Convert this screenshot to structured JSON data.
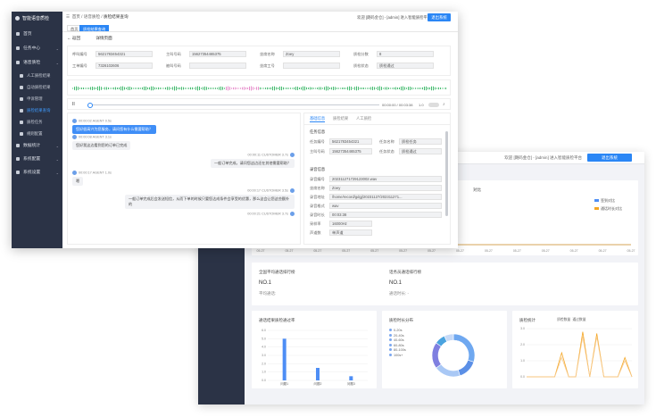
{
  "back_window": {
    "top_text": "欢迎 [朗码金仓] - [admin] 进入智能质检平台",
    "top_button": "退出系统",
    "chart_title": "对比",
    "legend": [
      "签到对比",
      "通话时长对比"
    ],
    "cards": [
      {
        "title": "全国平均通话排行榜",
        "value": "NO.1",
        "sub": "平均通话:"
      },
      {
        "title": "话务员通话排行榜",
        "value": "NO.1",
        "sub": "通话时长:  -"
      }
    ],
    "bar_panel_title": "通话结果质检通过率",
    "pie_panel_title": "质检时长分布",
    "pie_legend": [
      "0-20s",
      "20-40s",
      "40-60s",
      "60-80s",
      "80-100s",
      "100s+"
    ],
    "line_panel_title": "质检统计",
    "line_legend": [
      "质检数量",
      "通过数量"
    ],
    "colors": {
      "blue": "#4e8ef5",
      "orange": "#f5a623",
      "side": "#2b3346"
    }
  },
  "front": {
    "logo": "智能语音质检",
    "nav": [
      {
        "label": "首页",
        "sub": false,
        "active": false
      },
      {
        "label": "任务中心",
        "sub": false,
        "active": false,
        "chev": true
      },
      {
        "label": "语音质检",
        "sub": false,
        "active": false,
        "chev": true
      },
      {
        "label": "人工质检结果",
        "sub": true,
        "active": false
      },
      {
        "label": "自动质检结果",
        "sub": true,
        "active": false
      },
      {
        "label": "申诉管理",
        "sub": true,
        "active": false
      },
      {
        "label": "质检结果查询",
        "sub": true,
        "active": true
      },
      {
        "label": "质检任务",
        "sub": true,
        "active": false
      },
      {
        "label": "规则配置",
        "sub": true,
        "active": false
      },
      {
        "label": "数据统计",
        "sub": false,
        "active": false,
        "chev": true
      },
      {
        "label": "系统配置",
        "sub": false,
        "active": false,
        "chev": true
      },
      {
        "label": "系统设置",
        "sub": false,
        "active": false,
        "chev": true
      }
    ],
    "breadcrumb": [
      "首页",
      "语音质检",
      "质检结果查询"
    ],
    "top_hint": "欢迎 [朗码金仓] - [admin] 进入智能质检平台",
    "logout": "退出系统",
    "tabs": [
      {
        "label": "首页",
        "on": false
      },
      {
        "label": "质检结果查询",
        "on": true
      }
    ],
    "back_label": "返回",
    "detail_title": "详情页面",
    "info_rows": [
      [
        {
          "label": "呼叫编号",
          "value": "5621783454321"
        },
        {
          "label": "主叫号码",
          "value": "15627354465375"
        },
        {
          "label": "坐席名称",
          "value": "Zoey"
        },
        {
          "label": "质检分数",
          "value": "8"
        }
      ],
      [
        {
          "label": "工单编号",
          "value": "7326102606"
        },
        {
          "label": "被叫号码",
          "value": ""
        },
        {
          "label": "坐席工号",
          "value": ""
        },
        {
          "label": "质检状态",
          "value": "质检通过"
        }
      ]
    ],
    "player": {
      "time": "00:00:00 / 00:03:38",
      "speed": "1.0",
      "pause": "II"
    },
    "messages": [
      {
        "side": "left",
        "meta": "00:00:02 AGENT 0.5s",
        "text": "您好很高兴为您服务，请问您有什么需要帮助？",
        "style": "blue"
      },
      {
        "side": "left",
        "meta": "00:00:08 AGENT 3.1s",
        "text": "您好我这边看到您的订单已完成",
        "style": "grey"
      },
      {
        "side": "right",
        "meta": "00:00:11 CUSTOMER 3.7s",
        "text": "一般订单完成，请问您这边还在其他需要帮助？",
        "style": "grey"
      },
      {
        "side": "left",
        "meta": "00:00:17 AGENT 1.0s",
        "text": "嗯",
        "style": "grey"
      },
      {
        "side": "right",
        "meta": "00:00:17 CUSTOMER 3.5s",
        "text": "一般订单完成后会发送短信，从而下单的时候只要您达成条件会享受的优惠，那么这会让您这些额外的",
        "style": "grey"
      },
      {
        "side": "right",
        "meta": "00:00:21 CUSTOMER 3.7s",
        "text": "",
        "style": "grey"
      }
    ],
    "right_tabs": [
      {
        "label": "基础信息",
        "on": true
      },
      {
        "label": "质检结果",
        "on": false
      },
      {
        "label": "人工质检",
        "on": false
      }
    ],
    "task_section": "任务信息",
    "task_fields": [
      {
        "label": "任务编号",
        "value": "5621783454321"
      },
      {
        "label": "任务名称",
        "value": "质检任务"
      },
      {
        "label": "主叫号码",
        "value": "15627354465375"
      },
      {
        "label": "任务状态",
        "value": "质检通过"
      }
    ],
    "record_section": "录音信息",
    "record_fields": [
      {
        "label": "录音编号",
        "value": "202311271729123002.wav"
      },
      {
        "label": "坐席名称",
        "value": "Zoey"
      },
      {
        "label": "录音地址",
        "value": "/home/record/gdgj/20231127/202311271..."
      },
      {
        "label": "录音格式",
        "value": "wav"
      },
      {
        "label": "录音时长",
        "value": "00:03:38"
      }
    ],
    "extra_fields": [
      {
        "label": "采样率",
        "value": "16000Hz"
      },
      {
        "label": "声道数",
        "value": "单声道"
      }
    ]
  },
  "chart_data": [
    {
      "type": "line",
      "title": "对比",
      "series": [
        {
          "name": "签到对比",
          "values": [
            0,
            0,
            0,
            0,
            0,
            0,
            0,
            0,
            0,
            0,
            0,
            0,
            0,
            0
          ]
        },
        {
          "name": "通话时长对比",
          "values": [
            0,
            0,
            0,
            0,
            0,
            0,
            0,
            0,
            0,
            0,
            0,
            0,
            0,
            0
          ]
        }
      ],
      "x": [
        "05-27",
        "05-27",
        "05-27",
        "05-27",
        "05-27",
        "05-27",
        "05-27",
        "05-27",
        "05-27",
        "05-27",
        "05-27",
        "05-27",
        "05-27",
        "05-27"
      ]
    },
    {
      "type": "bar",
      "title": "通话结果质检通过率",
      "categories": [
        "问题1",
        "问题2",
        "问题3"
      ],
      "values": [
        5,
        1.5,
        0.5
      ],
      "ylim": [
        0,
        6
      ]
    },
    {
      "type": "pie",
      "title": "质检时长分布",
      "categories": [
        "0-20s",
        "20-40s",
        "40-60s",
        "60-80s",
        "80-100s",
        "100s+"
      ],
      "values": [
        30,
        15,
        20,
        20,
        8,
        7
      ]
    },
    {
      "type": "line",
      "title": "质检统计",
      "series": [
        {
          "name": "质检数量",
          "values": [
            0,
            0,
            0,
            0,
            0,
            1.5,
            0,
            0,
            2.8,
            0,
            2.7,
            0,
            0,
            0,
            1.2,
            0
          ]
        },
        {
          "name": "通过数量",
          "values": [
            0,
            0,
            0,
            0,
            0,
            1.2,
            0,
            0,
            2.5,
            0,
            2.5,
            0,
            0,
            0,
            1.0,
            0
          ]
        }
      ],
      "ylim": [
        0,
        3
      ]
    }
  ]
}
